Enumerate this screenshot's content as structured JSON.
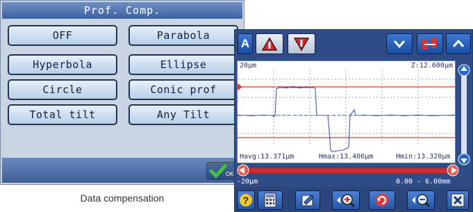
{
  "left_panel": {
    "title": "Prof. Comp.",
    "options": [
      {
        "label": "OFF",
        "selected": true
      },
      {
        "label": "Parabola",
        "selected": false
      },
      {
        "label": "Hyperbola",
        "selected": false
      },
      {
        "label": "Ellipse",
        "selected": false
      },
      {
        "label": "Circle",
        "selected": false
      },
      {
        "label": "Conic prof",
        "selected": false
      },
      {
        "label": "Total tilt",
        "selected": false
      },
      {
        "label": "Any Tilt",
        "selected": false
      }
    ],
    "ok_icon": "ok-check-icon"
  },
  "caption": "Data compensation",
  "right_panel": {
    "toolbar_icons": [
      "a-mode-icon",
      "upper-cursor-icon",
      "lower-cursor-icon",
      "chevron-down-icon",
      "cursor-link-icon",
      "chevron-up-icon"
    ],
    "graph": {
      "scale_label": "20μm",
      "z_readout": "Z:12.600μm",
      "havg": "Havg:13.371μm",
      "hmax": "Hmax:13.406μm",
      "hmin": "Hmin:13.320μm",
      "x_range": "0.00 - 6.00mm",
      "x_min_label": "-20μm"
    },
    "bottom_icons": [
      "help-icon",
      "calculator-icon",
      "edit-icon",
      "zoom-in-icon",
      "refresh-icon",
      "zoom-out-icon",
      "close-icon"
    ],
    "colors": {
      "panel": "#2f4c86",
      "profile": "#3d57b8",
      "cursor": "#e03030"
    }
  }
}
